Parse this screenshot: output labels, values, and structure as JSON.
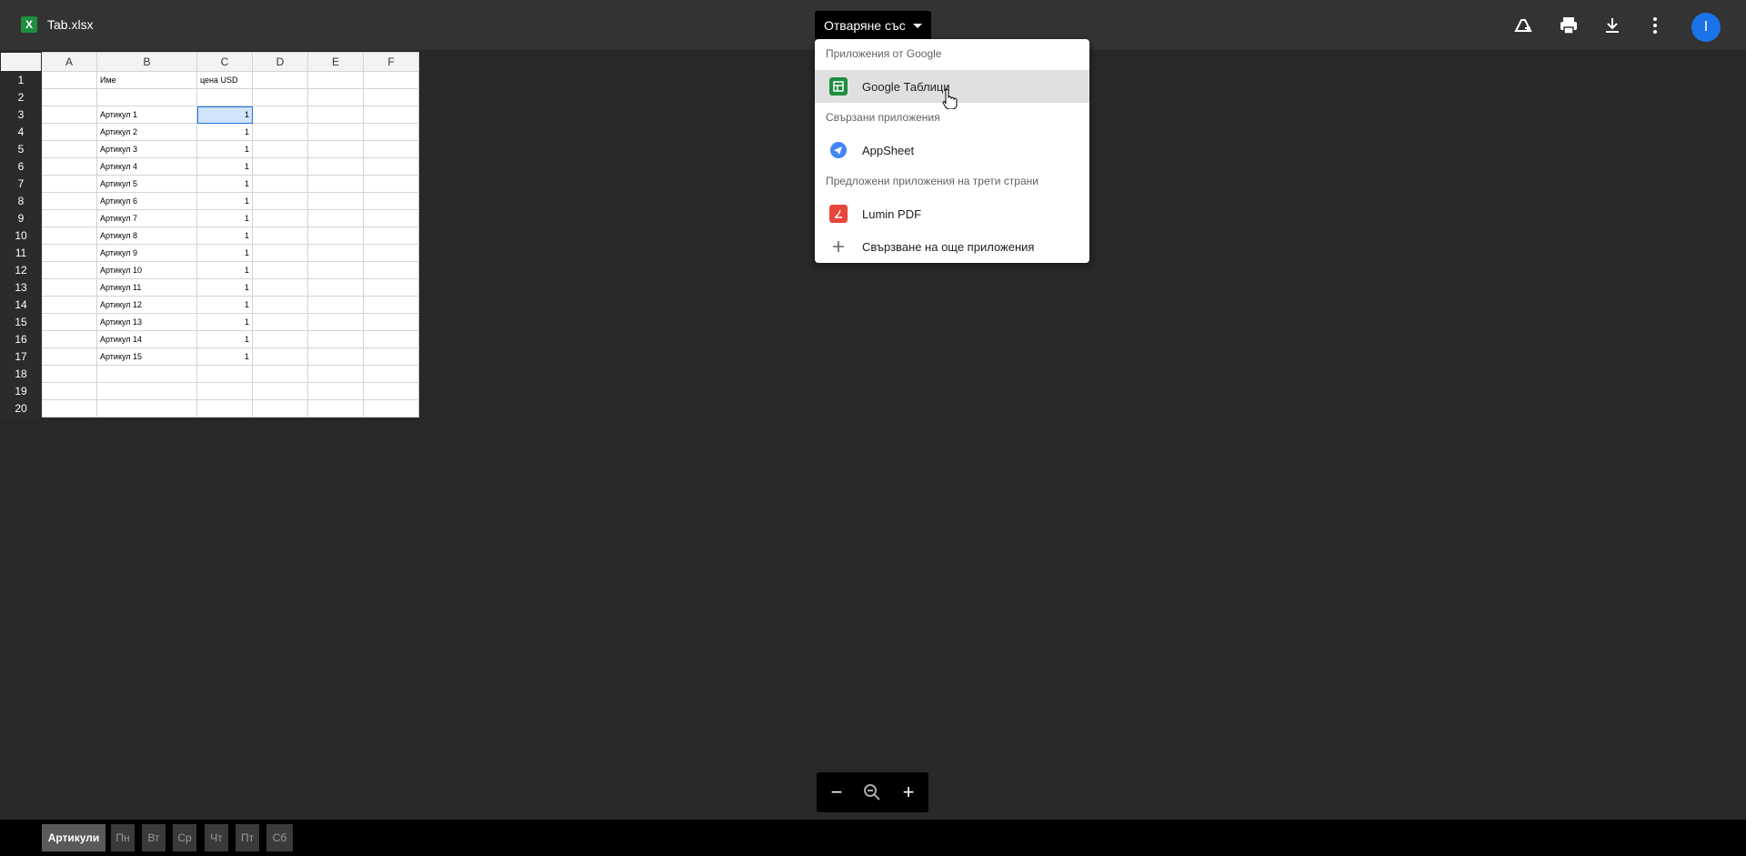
{
  "header": {
    "file_icon_letter": "X",
    "file_name": "Tab.xlsx",
    "open_with_label": "Отваряне със",
    "avatar_letter": "I"
  },
  "sheet": {
    "columns": [
      "A",
      "B",
      "C",
      "D",
      "E",
      "F"
    ],
    "rows": [
      {
        "n": "1",
        "b": "Име",
        "c": "цена USD"
      },
      {
        "n": "2",
        "b": "",
        "c": ""
      },
      {
        "n": "3",
        "b": "Артикул 1",
        "c": "1"
      },
      {
        "n": "4",
        "b": "Артикул 2",
        "c": "1"
      },
      {
        "n": "5",
        "b": "Артикул 3",
        "c": "1"
      },
      {
        "n": "6",
        "b": "Артикул 4",
        "c": "1"
      },
      {
        "n": "7",
        "b": "Артикул 5",
        "c": "1"
      },
      {
        "n": "8",
        "b": "Артикул 6",
        "c": "1"
      },
      {
        "n": "9",
        "b": "Артикул 7",
        "c": "1"
      },
      {
        "n": "10",
        "b": "Артикул 8",
        "c": "1"
      },
      {
        "n": "11",
        "b": "Артикул 9",
        "c": "1"
      },
      {
        "n": "12",
        "b": "Артикул 10",
        "c": "1"
      },
      {
        "n": "13",
        "b": "Артикул 11",
        "c": "1"
      },
      {
        "n": "14",
        "b": "Артикул 12",
        "c": "1"
      },
      {
        "n": "15",
        "b": "Артикул 13",
        "c": "1"
      },
      {
        "n": "16",
        "b": "Артикул 14",
        "c": "1"
      },
      {
        "n": "17",
        "b": "Артикул 15",
        "c": "1"
      },
      {
        "n": "18",
        "b": "",
        "c": ""
      },
      {
        "n": "19",
        "b": "",
        "c": ""
      },
      {
        "n": "20",
        "b": "",
        "c": ""
      }
    ]
  },
  "menu": {
    "section_google": "Приложения от Google",
    "google_sheets": "Google Таблици",
    "section_connected": "Свързани приложения",
    "appsheet": "AppSheet",
    "section_suggested": "Предложени приложения на трети страни",
    "lumin": "Lumin PDF",
    "connect_more": "Свързване на още приложения"
  },
  "tabs": [
    "Артикули",
    "Пн",
    "Вт",
    "Ср",
    "Чт",
    "Пт",
    "Сб"
  ],
  "colors": {
    "accent": "#1a73e8",
    "sheets_green": "#1e8e3e",
    "lumin_red": "#e8453c"
  }
}
